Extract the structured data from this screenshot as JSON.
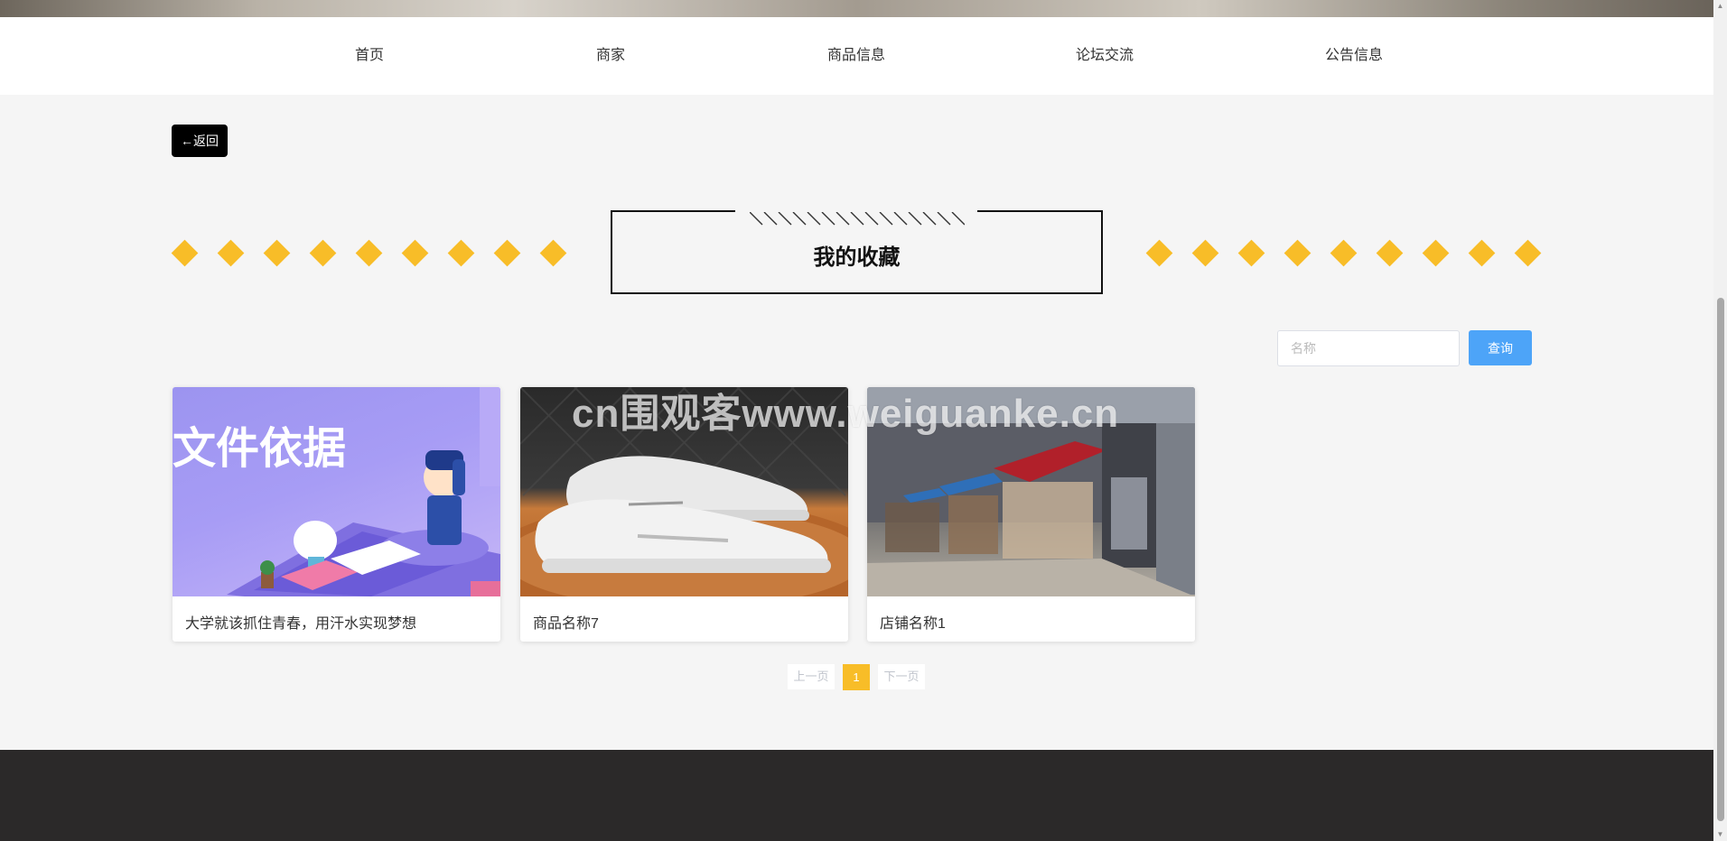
{
  "nav": {
    "items": [
      {
        "label": "首页"
      },
      {
        "label": "商家"
      },
      {
        "label": "商品信息"
      },
      {
        "label": "论坛交流"
      },
      {
        "label": "公告信息"
      }
    ]
  },
  "back": {
    "label": "←返回"
  },
  "section": {
    "title": "我的收藏"
  },
  "search": {
    "placeholder": "名称",
    "button_label": "查询"
  },
  "cards": [
    {
      "title": "大学就该抓住青春，用汗水实现梦想",
      "image_text": "文件依据"
    },
    {
      "title": "商品名称7"
    },
    {
      "title": "店铺名称1"
    }
  ],
  "watermark": "cn围观客www.weiguanke.cn",
  "pagination": {
    "prev": "上一页",
    "current": "1",
    "next": "下一页"
  },
  "colors": {
    "accent": "#f8bd28",
    "search_button": "#4da4f8",
    "footer": "#2b2929"
  }
}
